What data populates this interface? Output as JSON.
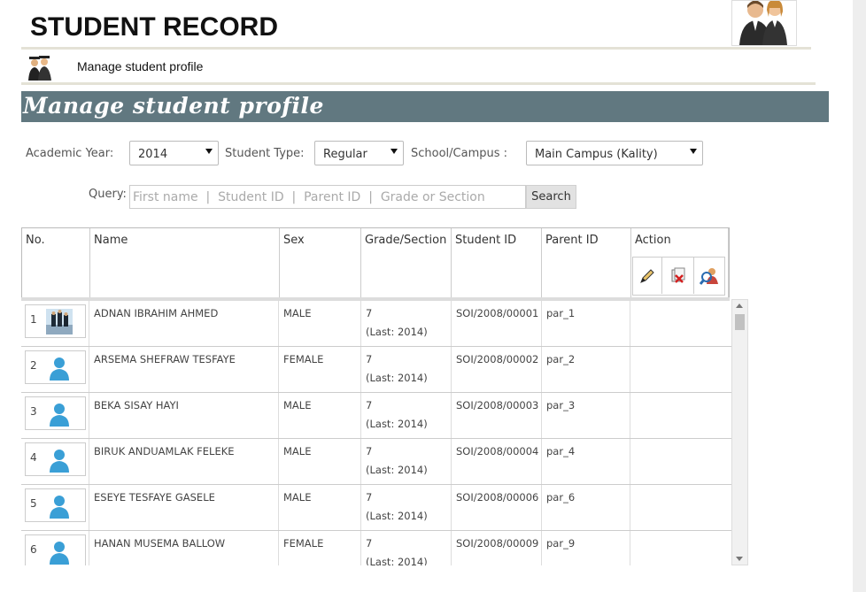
{
  "app": {
    "title": "STUDENT RECORD"
  },
  "nav": {
    "label": "Manage student profile"
  },
  "banner": {
    "title": "Manage student profile"
  },
  "filters": {
    "academic_year": {
      "label": "Academic Year:",
      "value": "2014"
    },
    "student_type": {
      "label": "Student Type:",
      "value": "Regular"
    },
    "campus": {
      "label": "School/Campus :",
      "value": "Main Campus (Kality)"
    }
  },
  "query": {
    "label": "Query:",
    "placeholder": "First name  |  Student ID  |  Parent ID  |  Grade or Section",
    "button": "Search"
  },
  "table": {
    "headers": {
      "no": "No.",
      "name": "Name",
      "sex": "Sex",
      "grade": "Grade/Section",
      "student_id": "Student ID",
      "parent_id": "Parent ID",
      "action": "Action"
    },
    "rows": [
      {
        "no": "1",
        "name": "ADNAN IBRAHIM AHMED",
        "sex": "MALE",
        "grade": "7",
        "last": "(Last: 2014)",
        "student_id": "SOI/2008/00001",
        "parent_id": "par_1",
        "photo": "photo"
      },
      {
        "no": "2",
        "name": "ARSEMA SHEFRAW TESFAYE",
        "sex": "FEMALE",
        "grade": "7",
        "last": "(Last: 2014)",
        "student_id": "SOI/2008/00002",
        "parent_id": "par_2",
        "photo": "default-user"
      },
      {
        "no": "3",
        "name": "BEKA SISAY HAYI",
        "sex": "MALE",
        "grade": "7",
        "last": "(Last: 2014)",
        "student_id": "SOI/2008/00003",
        "parent_id": "par_3",
        "photo": "default-user"
      },
      {
        "no": "4",
        "name": "BIRUK ANDUAMLAK FELEKE",
        "sex": "MALE",
        "grade": "7",
        "last": "(Last: 2014)",
        "student_id": "SOI/2008/00004",
        "parent_id": "par_4",
        "photo": "default-user"
      },
      {
        "no": "5",
        "name": "ESEYE TESFAYE GASELE",
        "sex": "MALE",
        "grade": "7",
        "last": "(Last: 2014)",
        "student_id": "SOI/2008/00006",
        "parent_id": "par_6",
        "photo": "default-user"
      },
      {
        "no": "6",
        "name": "HANAN MUSEMA BALLOW",
        "sex": "FEMALE",
        "grade": "7",
        "last": "(Last: 2014)",
        "student_id": "SOI/2008/00009",
        "parent_id": "par_9",
        "photo": "default-user"
      }
    ]
  },
  "icons": {
    "edit": "pencil-icon",
    "delete": "delete-record-icon",
    "view": "search-user-icon"
  },
  "colors": {
    "banner": "#617880",
    "user_icon": "#3a9fd6"
  }
}
